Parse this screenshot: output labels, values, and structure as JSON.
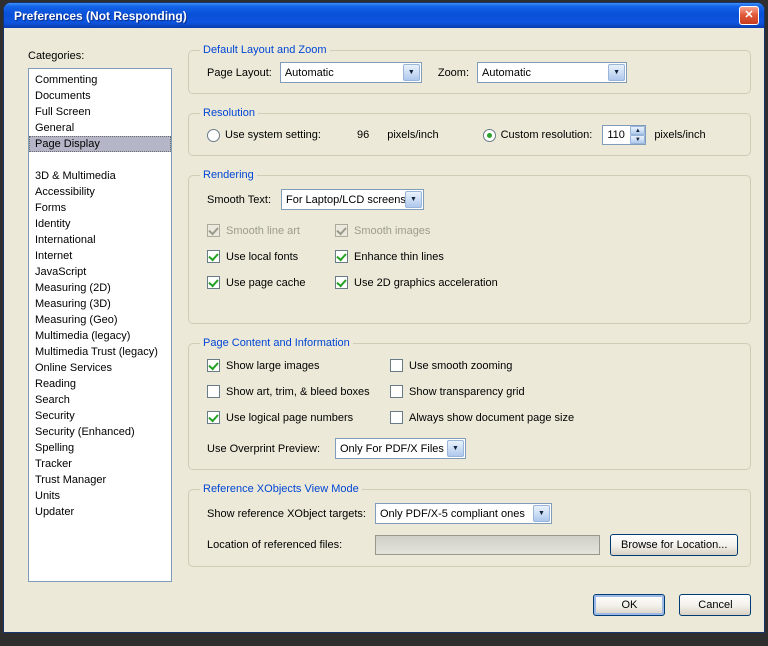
{
  "window": {
    "title": "Preferences (Not Responding)"
  },
  "icons": {
    "close": "✕",
    "dropdown_arrow": "▼",
    "spin_up": "▲",
    "spin_down": "▼"
  },
  "sidebar": {
    "label": "Categories:",
    "items": [
      {
        "label": "Commenting"
      },
      {
        "label": "Documents"
      },
      {
        "label": "Full Screen"
      },
      {
        "label": "General"
      },
      {
        "label": "Page Display",
        "selected": true
      },
      {
        "label": "3D & Multimedia",
        "gap": true
      },
      {
        "label": "Accessibility"
      },
      {
        "label": "Forms"
      },
      {
        "label": "Identity"
      },
      {
        "label": "International"
      },
      {
        "label": "Internet"
      },
      {
        "label": "JavaScript"
      },
      {
        "label": "Measuring (2D)"
      },
      {
        "label": "Measuring (3D)"
      },
      {
        "label": "Measuring (Geo)"
      },
      {
        "label": "Multimedia (legacy)"
      },
      {
        "label": "Multimedia Trust (legacy)"
      },
      {
        "label": "Online Services"
      },
      {
        "label": "Reading"
      },
      {
        "label": "Search"
      },
      {
        "label": "Security"
      },
      {
        "label": "Security (Enhanced)"
      },
      {
        "label": "Spelling"
      },
      {
        "label": "Tracker"
      },
      {
        "label": "Trust Manager"
      },
      {
        "label": "Units"
      },
      {
        "label": "Updater"
      }
    ]
  },
  "layout_zoom": {
    "title": "Default Layout and Zoom",
    "page_layout_label": "Page Layout:",
    "page_layout_value": "Automatic",
    "zoom_label": "Zoom:",
    "zoom_value": "Automatic"
  },
  "resolution": {
    "title": "Resolution",
    "system_label": "Use system setting:",
    "system_selected": false,
    "system_value": "96",
    "system_unit": "pixels/inch",
    "custom_label": "Custom resolution:",
    "custom_selected": true,
    "custom_value": "110",
    "custom_unit": "pixels/inch"
  },
  "rendering": {
    "title": "Rendering",
    "smooth_text_label": "Smooth Text:",
    "smooth_text_value": "For Laptop/LCD screens",
    "checkboxes": [
      {
        "label": "Smooth line art",
        "checked": true,
        "disabled": true
      },
      {
        "label": "Smooth images",
        "checked": true,
        "disabled": true
      },
      {
        "label": "Use local fonts",
        "checked": true
      },
      {
        "label": "Enhance thin lines",
        "checked": true
      },
      {
        "label": "Use page cache",
        "checked": true
      },
      {
        "label": "Use 2D graphics acceleration",
        "checked": true
      }
    ]
  },
  "page_content": {
    "title": "Page Content and Information",
    "checkboxes": [
      {
        "label": "Show large images",
        "checked": true
      },
      {
        "label": "Use smooth zooming"
      },
      {
        "label": "Show art, trim, & bleed boxes"
      },
      {
        "label": "Show transparency grid"
      },
      {
        "label": "Use logical page numbers",
        "checked": true
      },
      {
        "label": "Always show document page size"
      }
    ],
    "overprint_label": "Use Overprint Preview:",
    "overprint_value": "Only For PDF/X Files"
  },
  "xobjects": {
    "title": "Reference XObjects View Mode",
    "targets_label": "Show reference XObject targets:",
    "targets_value": "Only PDF/X-5 compliant ones",
    "location_label": "Location of referenced files:",
    "location_value": "",
    "browse_button": "Browse for Location..."
  },
  "footer": {
    "ok": "OK",
    "cancel": "Cancel"
  }
}
